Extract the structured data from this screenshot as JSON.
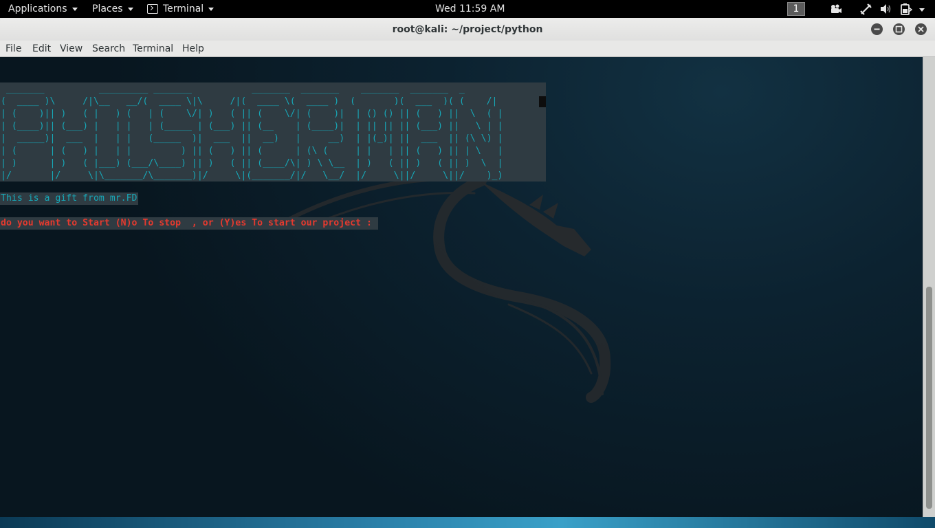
{
  "topbar": {
    "applications": "Applications",
    "places": "Places",
    "terminal_app": "Terminal",
    "clock": "Wed 11:59 AM",
    "workspace": "1"
  },
  "window": {
    "title": "root@kali: ~/project/python"
  },
  "menubar": {
    "items": [
      "File",
      "Edit",
      "View",
      "Search",
      "Terminal",
      "Help"
    ]
  },
  "terminal": {
    "banner": " _______          _________ _______           _______  _______    _______  _______  _\n(  ____ )\\     /|\\__   __/(  ____ \\|\\     /|(  ____ \\(  ____ )  (       )(  ___  )( (    /|\n| (    )|| )   ( |   ) (   | (    \\/| )   ( || (    \\/| (    )|  | () () || (   ) ||  \\  ( |\n| (____)|| (___) |   | |   | (_____ | (___) || (__    | (____)|  | || || || (___) ||   \\ | |\n|  _____)|  ___  |   | |   (_____  )|  ___  ||  __)   |     __)  | |(_)| ||  ___  || (\\ \\) |\n| (      | (   ) |   | |         ) || (   ) || (      | (\\ (     | |   | || (   ) || | \\   |\n| )      | )   ( |___) (___/\\____) || )   ( || (____/\\| ) \\ \\__  | )   ( || )   ( || )  \\  |\n|/       |/     \\|\\_______/\\_______)|/     \\|(_______/|/   \\__/  |/     \\||/     \\||/    )_)",
    "gift_line": "This is a gift from mr.FD",
    "prompt_line": "do you want to Start (N)o To stop  , or (Y)es To start our project : "
  },
  "colors": {
    "banner_text": "#17a8b8",
    "prompt_text": "#e53a2f",
    "highlight_bg": "#2f3b42",
    "terminal_bg": "#0c2230"
  },
  "icons": {
    "topbar_terminal": "terminal-icon",
    "tray": [
      "video-camera-icon",
      "network-icon",
      "volume-icon",
      "battery-icon",
      "power-menu-icon"
    ],
    "window_buttons": [
      "minimize-icon",
      "maximize-icon",
      "close-icon"
    ],
    "wallpaper": "kali-dragon-icon"
  }
}
